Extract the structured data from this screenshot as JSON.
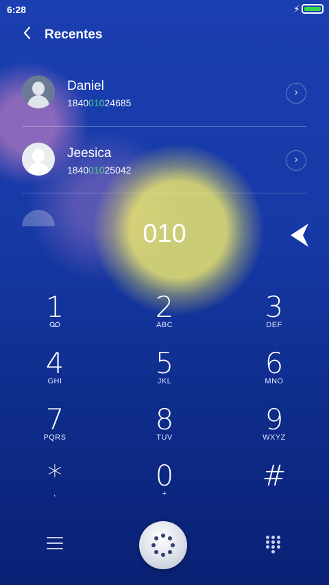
{
  "status_bar": {
    "time": "6:28",
    "battery_color": "#38d64d",
    "battery_level": 1.0
  },
  "header": {
    "title": "Recentes"
  },
  "contacts": [
    {
      "name": "Daniel",
      "number_pre": "1840",
      "number_match": "010",
      "number_post": "24685"
    },
    {
      "name": "Jeesica",
      "number_pre": "1840",
      "number_match": "010",
      "number_post": "25042"
    }
  ],
  "dial_input": {
    "value": "010"
  },
  "keypad": [
    {
      "digit": "1",
      "letters": ""
    },
    {
      "digit": "2",
      "letters": "ABC"
    },
    {
      "digit": "3",
      "letters": "DEF"
    },
    {
      "digit": "4",
      "letters": "GHI"
    },
    {
      "digit": "5",
      "letters": "JKL"
    },
    {
      "digit": "6",
      "letters": "MNO"
    },
    {
      "digit": "7",
      "letters": "PQRS"
    },
    {
      "digit": "8",
      "letters": "TUV"
    },
    {
      "digit": "9",
      "letters": "WXYZ"
    },
    {
      "digit": "*",
      "letters": ","
    },
    {
      "digit": "0",
      "letters": "+"
    },
    {
      "digit": "#",
      "letters": ""
    }
  ],
  "colors": {
    "match_highlight": "#52d08a",
    "background": "#1739a6"
  },
  "icons": {
    "back": "chevron-left-icon",
    "details": "chevron-right-icon",
    "backspace": "backspace-arrow-icon",
    "voicemail": "voicemail-icon",
    "menu": "menu-icon",
    "dialpad_toggle": "dialpad-icon",
    "dial_grid": "keypad-grid-icon"
  }
}
